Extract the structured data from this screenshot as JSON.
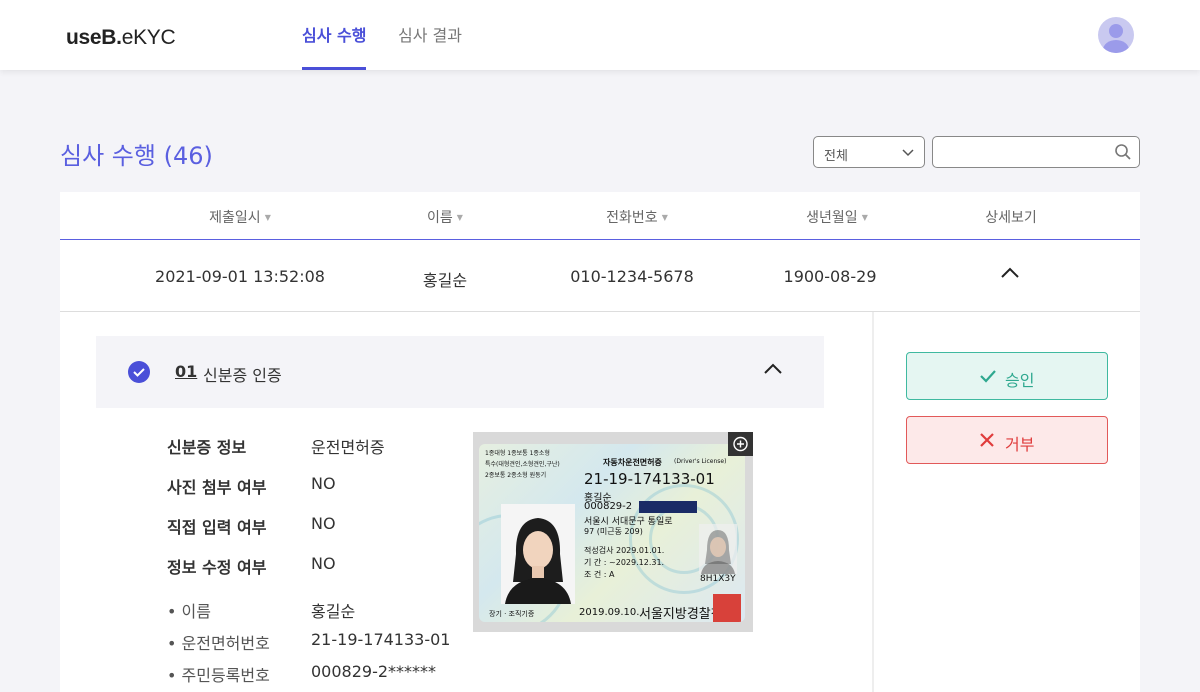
{
  "header": {
    "logo_bold": "useB.",
    "logo_light": "eKYC",
    "tabs": [
      {
        "label": "심사 수행",
        "active": true
      },
      {
        "label": "심사 결과",
        "active": false
      }
    ]
  },
  "page": {
    "title": "심사 수행 (46)",
    "filter": {
      "selected": "전체"
    },
    "search": {
      "value": "",
      "placeholder": ""
    }
  },
  "table": {
    "columns": [
      "제출일시",
      "이름",
      "전화번호",
      "생년월일",
      "상세보기"
    ],
    "sort_indicator": "▼",
    "rows": [
      {
        "submitted_at": "2021-09-01 13:52:08",
        "name": "홍길순",
        "phone": "010-1234-5678",
        "birth": "1900-08-29"
      }
    ]
  },
  "detail": {
    "step": {
      "number": "01",
      "title": "신분증 인증"
    },
    "info": [
      {
        "label": "신분증 정보",
        "value": "운전면허증"
      },
      {
        "label": "사진 첨부 여부",
        "value": "NO"
      },
      {
        "label": "직접 입력 여부",
        "value": "NO"
      },
      {
        "label": "정보 수정 여부",
        "value": "NO"
      }
    ],
    "fields": [
      {
        "label": "• 이름",
        "value": "홍길순"
      },
      {
        "label": "• 운전면허번호",
        "value": "21-19-174133-01"
      },
      {
        "label": "• 주민등록번호",
        "value": "000829-2******"
      }
    ],
    "card": {
      "header_left": "1종대형 1종보통 1종소형",
      "header_left2": "특수(대형견인,소형견인,구난)",
      "header_left3": "2종보통 2종소형 원동기",
      "title": "자동차운전면허증",
      "title_en": "(Driver's License)",
      "number": "21-19-174133-01",
      "name": "홍길순",
      "rrn": "000829-2",
      "addr1": "서울시 서대문구 통일로",
      "addr2": "97 (미근동 209)",
      "aptitude": "적성검사  2029.01.01.",
      "period": "기    간 : ~2029.12.31.",
      "cond": "조    건 : A",
      "code": "8H1X3Y",
      "issued": "2019.09.10.",
      "authority": "서울지방경찰청장",
      "footer_left": "장기 · 조직기증"
    },
    "actions": {
      "approve": "승인",
      "reject": "거부"
    }
  },
  "colors": {
    "primary": "#4a4fd8",
    "approve": "#2ea88f",
    "reject": "#e03c3c"
  }
}
